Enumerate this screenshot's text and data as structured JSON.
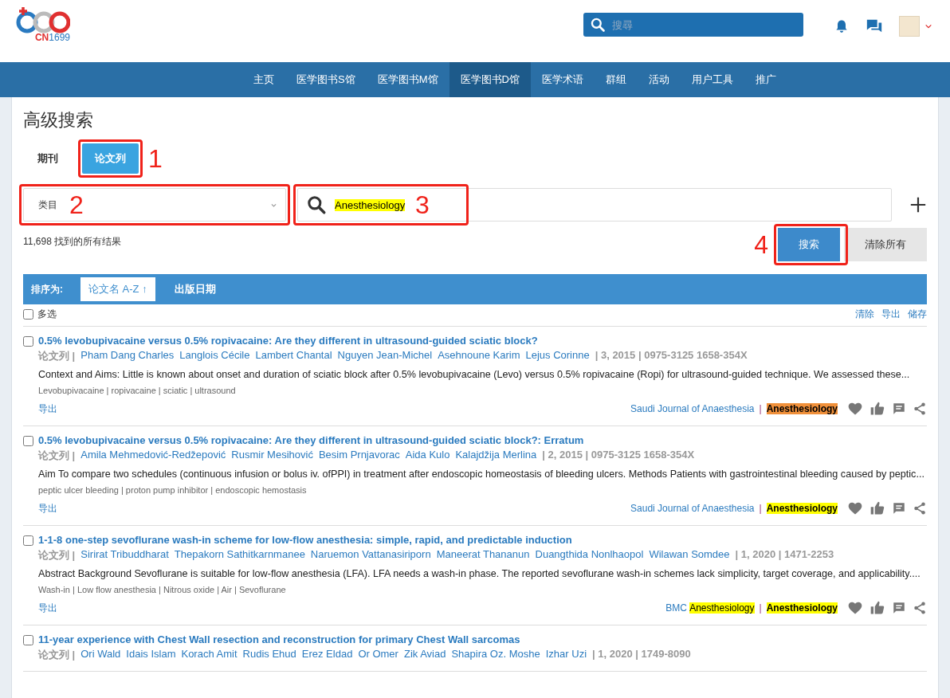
{
  "logo": {
    "text_a": "CN",
    "text_b": "1699"
  },
  "header": {
    "search_placeholder": "搜尋"
  },
  "nav": [
    {
      "label": "主页",
      "selected": false
    },
    {
      "label": "医学图书S馆",
      "selected": false
    },
    {
      "label": "医学图书M馆",
      "selected": false
    },
    {
      "label": "医学图书D馆",
      "selected": true
    },
    {
      "label": "医学术语",
      "selected": false
    },
    {
      "label": "群组",
      "selected": false
    },
    {
      "label": "活动",
      "selected": false
    },
    {
      "label": "用户工具",
      "selected": false
    },
    {
      "label": "推广",
      "selected": false
    }
  ],
  "page_title": "高级搜索",
  "tabs": [
    {
      "label": "期刊",
      "selected": false
    },
    {
      "label": "论文列",
      "selected": true,
      "annotation": "1"
    }
  ],
  "category_select": {
    "value": "类目",
    "annotation": "2"
  },
  "search_field": {
    "value": "Anesthesiology",
    "annotation": "3"
  },
  "result_count": "11,698 找到的所有结果",
  "buttons": [
    {
      "label": "搜索",
      "kind": "primary",
      "annotation": "4"
    },
    {
      "label": "清除所有",
      "kind": "secondary"
    }
  ],
  "sort": {
    "label": "排序为:",
    "options": [
      {
        "label": "论文名 A-Z",
        "arrow": "↑",
        "selected": true
      },
      {
        "label": "出版日期",
        "selected": false
      }
    ]
  },
  "select_all": {
    "label": "多选",
    "checked": false
  },
  "actions": [
    "清除",
    "导出",
    "储存"
  ],
  "results": [
    {
      "checked": false,
      "title": "0.5% levobupivacaine versus 0.5% ropivacaine: Are they different in ultrasound-guided sciatic block?",
      "type": "论文列 |",
      "authors": [
        "Pham Dang Charles",
        "Langlois Cécile",
        "Lambert Chantal",
        "Nguyen Jean-Michel",
        "Asehnoune Karim",
        "Lejus Corinne"
      ],
      "meta": "| 3, 2015 | 0975-3125 1658-354X",
      "abstract": "Context and Aims: Little is known about onset and duration of sciatic block after 0.5% levobupivacaine (Levo) versus 0.5% ropivacaine (Ropi) for ultrasound-guided technique. We assessed these...",
      "keywords": "Levobupivacaine | ropivacaine | sciatic | ultrasound",
      "export": "导出",
      "journal": [
        {
          "text": "Saudi Journal of Anaesthesia",
          "highlight": false
        }
      ],
      "separator": "|",
      "subject": {
        "text": "Anesthesiology",
        "color": "#f0903a"
      }
    },
    {
      "checked": false,
      "title": "0.5% levobupivacaine versus 0.5% ropivacaine: Are they different in ultrasound-guided sciatic block?: Erratum",
      "type": "论文列 |",
      "authors": [
        "Amila Mehmedović-Redžepović",
        "Rusmir Mesihović",
        "Besim Prnjavorac",
        "Aida Kulo",
        "Kalajdžija Merlina"
      ],
      "meta": "| 2, 2015 | 0975-3125 1658-354X",
      "abstract": "Aim To compare two schedules (continuous infusion or bolus iv. ofPPI) in treatment after endoscopic homeostasis of bleeding ulcers. Methods Patients with gastrointestinal bleeding caused by peptic...",
      "keywords": "peptic ulcer bleeding | proton pump inhibitor | endoscopic hemostasis",
      "export": "导出",
      "journal": [
        {
          "text": "Saudi Journal of Anaesthesia",
          "highlight": false
        }
      ],
      "separator": "|",
      "subject": {
        "text": "Anesthesiology",
        "color": "#ffff00"
      }
    },
    {
      "checked": false,
      "title": "1-1-8 one-step sevoflurane wash-in scheme for low-flow anesthesia: simple, rapid, and predictable induction",
      "type": "论文列 |",
      "authors": [
        "Sirirat Tribuddharat",
        "Thepakorn Sathitkarnmanee",
        "Naruemon Vattanasiriporn",
        "Maneerat Thananun",
        "Duangthida Nonlhaopol",
        "Wilawan Somdee"
      ],
      "meta": "| 1, 2020 | 1471-2253",
      "abstract": "Abstract Background Sevoflurane is suitable for low-flow anesthesia (LFA). LFA needs a wash-in phase. The reported sevoflurane wash-in schemes lack simplicity, target coverage, and applicability....",
      "keywords": "Wash-in | Low flow anesthesia | Nitrous oxide | Air | Sevoflurane",
      "export": "导出",
      "journal": [
        {
          "text": "BMC ",
          "highlight": false
        },
        {
          "text": "Anesthesiology",
          "highlight": true
        }
      ],
      "separator": "|",
      "subject": {
        "text": "Anesthesiology",
        "color": "#ffff00"
      }
    },
    {
      "checked": false,
      "title": "11-year experience with Chest Wall resection and reconstruction for primary Chest Wall sarcomas",
      "type": "论文列 |",
      "authors": [
        "Ori Wald",
        "Idais Islam",
        "Korach Amit",
        "Rudis Ehud",
        "Erez Eldad",
        "Or Omer",
        "Zik Aviad",
        "Shapira Oz. Moshe",
        "Izhar Uzi"
      ],
      "meta": "| 1, 2020 | 1749-8090"
    }
  ]
}
